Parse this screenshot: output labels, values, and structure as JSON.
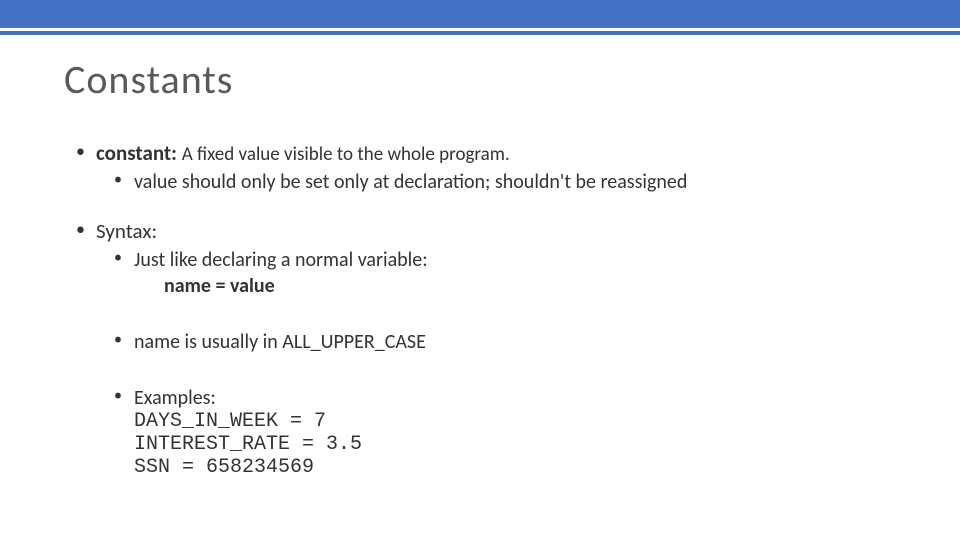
{
  "slide": {
    "title": "Constants",
    "bullets": {
      "b1": {
        "term": "constant:",
        "definition": "A fixed value visible to the whole program.",
        "sub1": "value should only be set only at declaration;  shouldn't be reassigned"
      },
      "b2": {
        "label": "Syntax:",
        "sub1": "Just like declaring a normal variable:",
        "syntax": "name  =  value",
        "sub2": "name is usually in ALL_UPPER_CASE",
        "sub3": "Examples:",
        "ex1": "DAYS_IN_WEEK = 7",
        "ex2": "INTEREST_RATE = 3.5",
        "ex3": "SSN = 658234569"
      }
    }
  }
}
